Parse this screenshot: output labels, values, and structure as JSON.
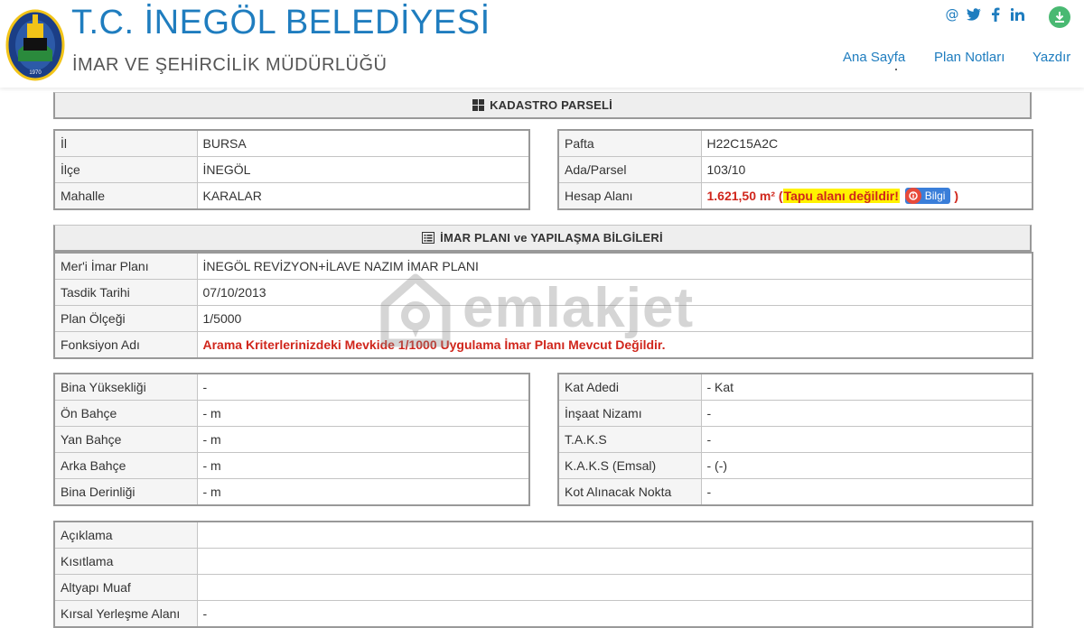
{
  "header": {
    "title": "T.C. İNEGÖL BELEDİYESİ",
    "subtitle": "İMAR VE ŞEHİRCİLİK MÜDÜRLÜĞÜ",
    "logo_year": "1970",
    "nav": {
      "home": "Ana Sayfa",
      "plan_notes": "Plan Notları",
      "print": "Yazdır"
    },
    "social_icons": [
      "email-icon",
      "twitter-icon",
      "facebook-icon",
      "linkedin-icon",
      "download-icon"
    ],
    "colors": {
      "brand_blue": "#1f7dbf",
      "download_green": "#49b972"
    }
  },
  "kadastro": {
    "heading": "KADASTRO PARSELİ",
    "left_rows": [
      {
        "label": "İl",
        "value": "BURSA"
      },
      {
        "label": "İlçe",
        "value": "İNEGÖL"
      },
      {
        "label": "Mahalle",
        "value": "KARALAR"
      }
    ],
    "right_rows": [
      {
        "label": "Pafta",
        "value": "H22C15A2C"
      },
      {
        "label": "Ada/Parsel",
        "value": "103/10"
      },
      {
        "label": "Hesap Alanı",
        "value": "1.621,50 m²",
        "open_paren": "(",
        "warning": "Tapu alanı değildir!",
        "info_button": "Bilgi",
        "close_paren": ")"
      }
    ]
  },
  "imar": {
    "heading": "İMAR PLANI ve YAPILAŞMA BİLGİLERİ",
    "rows": [
      {
        "label": "Mer'i İmar Planı",
        "value": "İNEGÖL REVİZYON+İLAVE NAZIM İMAR PLANI"
      },
      {
        "label": "Tasdik Tarihi",
        "value": "07/10/2013"
      },
      {
        "label": "Plan Ölçeği",
        "value": "1/5000"
      },
      {
        "label": "Fonksiyon Adı",
        "value": "Arama Kriterlerinizdeki Mevkide 1/1000 Uygulama İmar Planı Mevcut Değildir."
      }
    ]
  },
  "yapilasma": {
    "left_rows": [
      {
        "label": "Bina Yüksekliği",
        "value": "-"
      },
      {
        "label": "Ön Bahçe",
        "value": "- m"
      },
      {
        "label": "Yan Bahçe",
        "value": "- m"
      },
      {
        "label": "Arka Bahçe",
        "value": "- m"
      },
      {
        "label": "Bina Derinliği",
        "value": "- m"
      }
    ],
    "right_rows": [
      {
        "label": "Kat Adedi",
        "value": "- Kat"
      },
      {
        "label": "İnşaat Nizamı",
        "value": "-"
      },
      {
        "label": "T.A.K.S",
        "value": "-"
      },
      {
        "label": "K.A.K.S (Emsal)",
        "value": "- (-)"
      },
      {
        "label": "Kot Alınacak Nokta",
        "value": "-"
      }
    ]
  },
  "notes": {
    "rows": [
      {
        "label": "Açıklama",
        "value": ""
      },
      {
        "label": "Kısıtlama",
        "value": ""
      },
      {
        "label": "Altyapı Muaf",
        "value": ""
      },
      {
        "label": "Kırsal Yerleşme Alanı",
        "value": "-"
      }
    ]
  },
  "watermark": {
    "text": "emlakjet"
  }
}
